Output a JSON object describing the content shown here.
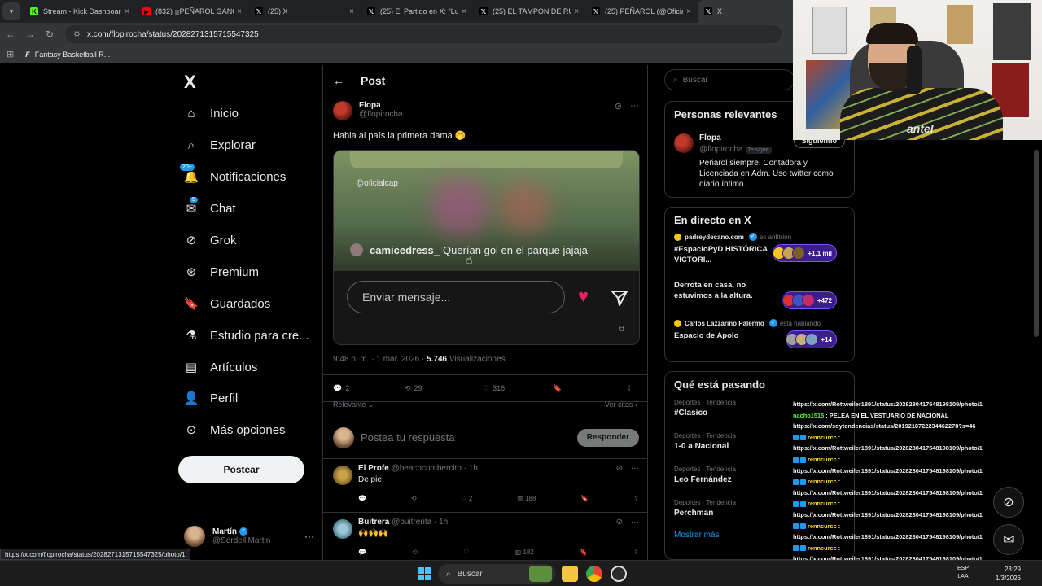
{
  "browser": {
    "tabs": [
      {
        "title": "Stream - Kick Dashboard",
        "favicon": "K",
        "color": "#53fc18"
      },
      {
        "title": "(832) ¡¡PEÑAROL GANÓ",
        "favicon": "▶",
        "color": "#ff0000"
      },
      {
        "title": "(25) X",
        "favicon": "𝕏",
        "color": "#000000"
      },
      {
        "title": "(25) El Partido en X: \"Luca",
        "favicon": "𝕏",
        "color": "#000000"
      },
      {
        "title": "(25) EL TAMPON DE RUGBY",
        "favicon": "𝕏",
        "color": "#000000"
      },
      {
        "title": "(25) PEÑAROL (@OficialC",
        "favicon": "𝕏",
        "color": "#000000"
      },
      {
        "title": "X",
        "favicon": "𝕏",
        "color": "#000000"
      }
    ],
    "url": "x.com/flopirocha/status/2028271315715547325",
    "bookmark": "Fantasy Basketball R...",
    "status_url": "https://x.com/flopirocha/status/2028271315715547325/photo/1"
  },
  "nav": {
    "logo": "X",
    "items": [
      {
        "label": "Inicio",
        "icon": "home-icon"
      },
      {
        "label": "Explorar",
        "icon": "search-icon"
      },
      {
        "label": "Notificaciones",
        "icon": "bell-icon",
        "badge": "20+"
      },
      {
        "label": "Chat",
        "icon": "mail-icon",
        "badge": "5"
      },
      {
        "label": "Grok",
        "icon": "grok-icon"
      },
      {
        "label": "Premium",
        "icon": "premium-icon"
      },
      {
        "label": "Guardados",
        "icon": "bookmark-icon"
      },
      {
        "label": "Estudio para cre...",
        "icon": "flask-icon"
      },
      {
        "label": "Artículos",
        "icon": "article-icon"
      },
      {
        "label": "Perfil",
        "icon": "person-icon"
      },
      {
        "label": "Más opciones",
        "icon": "more-circle-icon"
      }
    ],
    "post_button": "Postear",
    "account": {
      "name": "Martín",
      "handle": "@SordelliMartin"
    }
  },
  "main": {
    "header": "Post",
    "post": {
      "author": "Flopa",
      "handle": "@flopirocha",
      "text": "Habla al país la primera dama 🤭",
      "media": {
        "watermark": "@oficialcap",
        "comment_user": "camicedress_",
        "comment_text": "Querían gol en el parque jajaja",
        "message_placeholder": "Enviar mensaje..."
      },
      "time": "9:48 p. m. · 1 mar. 2026 · ",
      "views_count": "5.746",
      "views_label": " Visualizaciones",
      "replies": "2",
      "reposts": "29",
      "likes": "316",
      "sort": "Relevante",
      "quotes": "Ver citas"
    },
    "compose": {
      "placeholder": "Postea tu respuesta",
      "button": "Responder"
    },
    "replies": [
      {
        "name": "El Profe",
        "meta": "@beachcombercito · 1h",
        "text": "De pie",
        "replies": "",
        "reposts": "",
        "likes": "2",
        "views": "188"
      },
      {
        "name": "Buitrera",
        "meta": "@buitrerita · 1h",
        "text": "🙌🙌🙌",
        "replies": "",
        "reposts": "",
        "likes": "",
        "views": "182"
      }
    ]
  },
  "sidebar": {
    "search_placeholder": "Buscar",
    "relevant": {
      "title": "Personas relevantes",
      "name": "Flopa",
      "handle": "@flopirocha",
      "tag": "Te sigue",
      "button": "Siguiendo",
      "bio": "Peñarol siempre. Contadora y Licenciada en Adm. Uso twitter como diario íntimo."
    },
    "live": {
      "title": "En directo en X",
      "items": [
        {
          "host": "padreydecano.com",
          "sub": "es anfitrión",
          "title": "#EspacioPyD HISTÓRICA VICTORI...",
          "count": "+1,1 mil"
        },
        {
          "host": "",
          "sub": "",
          "title": "Derrota en casa, no estuvimos a la altura.",
          "count": "+472"
        },
        {
          "host": "Carlos Lazzarino Palermo",
          "sub": "está hablando",
          "title": "Espacio de Apolo",
          "count": "+14"
        }
      ]
    },
    "trends": {
      "title": "Qué está pasando",
      "items": [
        {
          "category": "Deportes · Tendencia",
          "name": "#Clasico"
        },
        {
          "category": "Deportes · Tendencia",
          "name": "1-0 a Nacional"
        },
        {
          "category": "Deportes · Tendencia",
          "name": "Leo Fernández"
        },
        {
          "category": "Deportes · Tendencia",
          "name": "Perchman"
        }
      ],
      "more": "Mostrar más"
    }
  },
  "webcam": {
    "shirt_text": "antel"
  },
  "chat": [
    {
      "user": "",
      "text": "https://x.com/Rottweiler1891/status/2028280417548198109/photo/1"
    },
    {
      "user": "nacho1515",
      "text": " : PELEA EN EL VESTUARIO DE NACIONAL",
      "green": true
    },
    {
      "user": "",
      "text": "https://x.com/soytendencias/status/2019218722234462278?s=46"
    },
    {
      "user": "renncurcc",
      "text": " :",
      "badge": true
    },
    {
      "user": "",
      "text": "https://x.com/Rottweiler1891/status/2028280417548198109/photo/1"
    },
    {
      "user": "renncurcc",
      "text": " :",
      "badge": true
    },
    {
      "user": "",
      "text": "https://x.com/Rottweiler1891/status/2028280417548198109/photo/1"
    },
    {
      "user": "renncurcc",
      "text": " :",
      "badge": true
    },
    {
      "user": "",
      "text": "https://x.com/Rottweiler1891/status/2028280417548198109/photo/1"
    },
    {
      "user": "renncurcc",
      "text": " :",
      "badge": true
    },
    {
      "user": "",
      "text": "https://x.com/Rottweiler1891/status/2028280417548198109/photo/1"
    },
    {
      "user": "renncurcc",
      "text": " :",
      "badge": true
    },
    {
      "user": "",
      "text": "https://x.com/Rottweiler1891/status/2028280417548198109/photo/1"
    },
    {
      "user": "renncurcc",
      "text": " :",
      "badge": true
    },
    {
      "user": "",
      "text": "https://x.com/Rottweiler1891/status/2028280417548198109/photo/1"
    }
  ],
  "taskbar": {
    "search": "Buscar",
    "lang_top": "ESP",
    "lang_bottom": "LAA",
    "time": "23:29",
    "date": "1/3/2026"
  },
  "colors": {
    "accent": "#1d9bf0",
    "like": "#e0245e",
    "kick": "#53fc18"
  }
}
